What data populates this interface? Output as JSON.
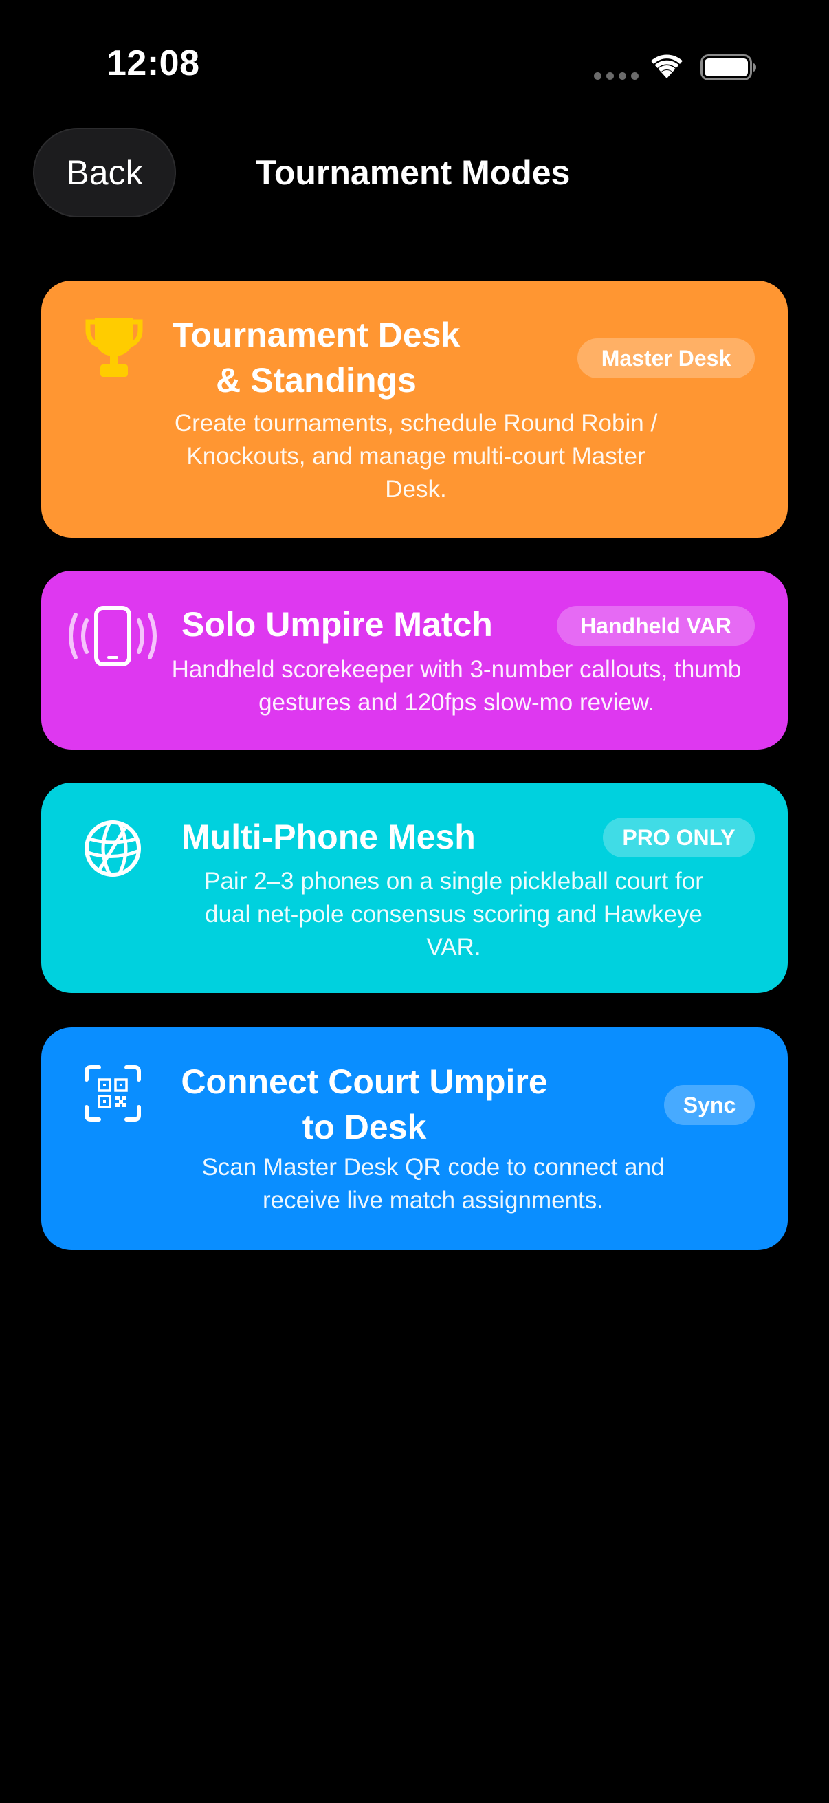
{
  "status_bar": {
    "time": "12:08"
  },
  "nav": {
    "back_label": "Back",
    "title": "Tournament Modes"
  },
  "colors": {
    "tournament": "#ff9632",
    "solo": "#de38f0",
    "mesh": "#00d1de",
    "connect": "#0a8eff",
    "trophy": "#ffcc00"
  },
  "modes": [
    {
      "icon": "trophy-icon",
      "title": "Tournament Desk & Standings",
      "badge": "Master Desk",
      "description": "Create tournaments, schedule Round Robin / Knockouts, and manage multi-court Master Desk."
    },
    {
      "icon": "phone-vibrate-icon",
      "title": "Solo Umpire Match",
      "badge": "Handheld VAR",
      "description": "Handheld scorekeeper with 3-number callouts, thumb gestures and 120fps slow-mo review."
    },
    {
      "icon": "globe-network-icon",
      "title": "Multi-Phone Mesh",
      "badge": "PRO ONLY",
      "description": "Pair 2–3 phones on a single pickleball court for dual net-pole consensus scoring and Hawkeye VAR."
    },
    {
      "icon": "qr-scan-icon",
      "title": "Connect Court Umpire to Desk",
      "badge": "Sync",
      "description": "Scan Master Desk QR code to connect and receive live match assignments."
    }
  ]
}
